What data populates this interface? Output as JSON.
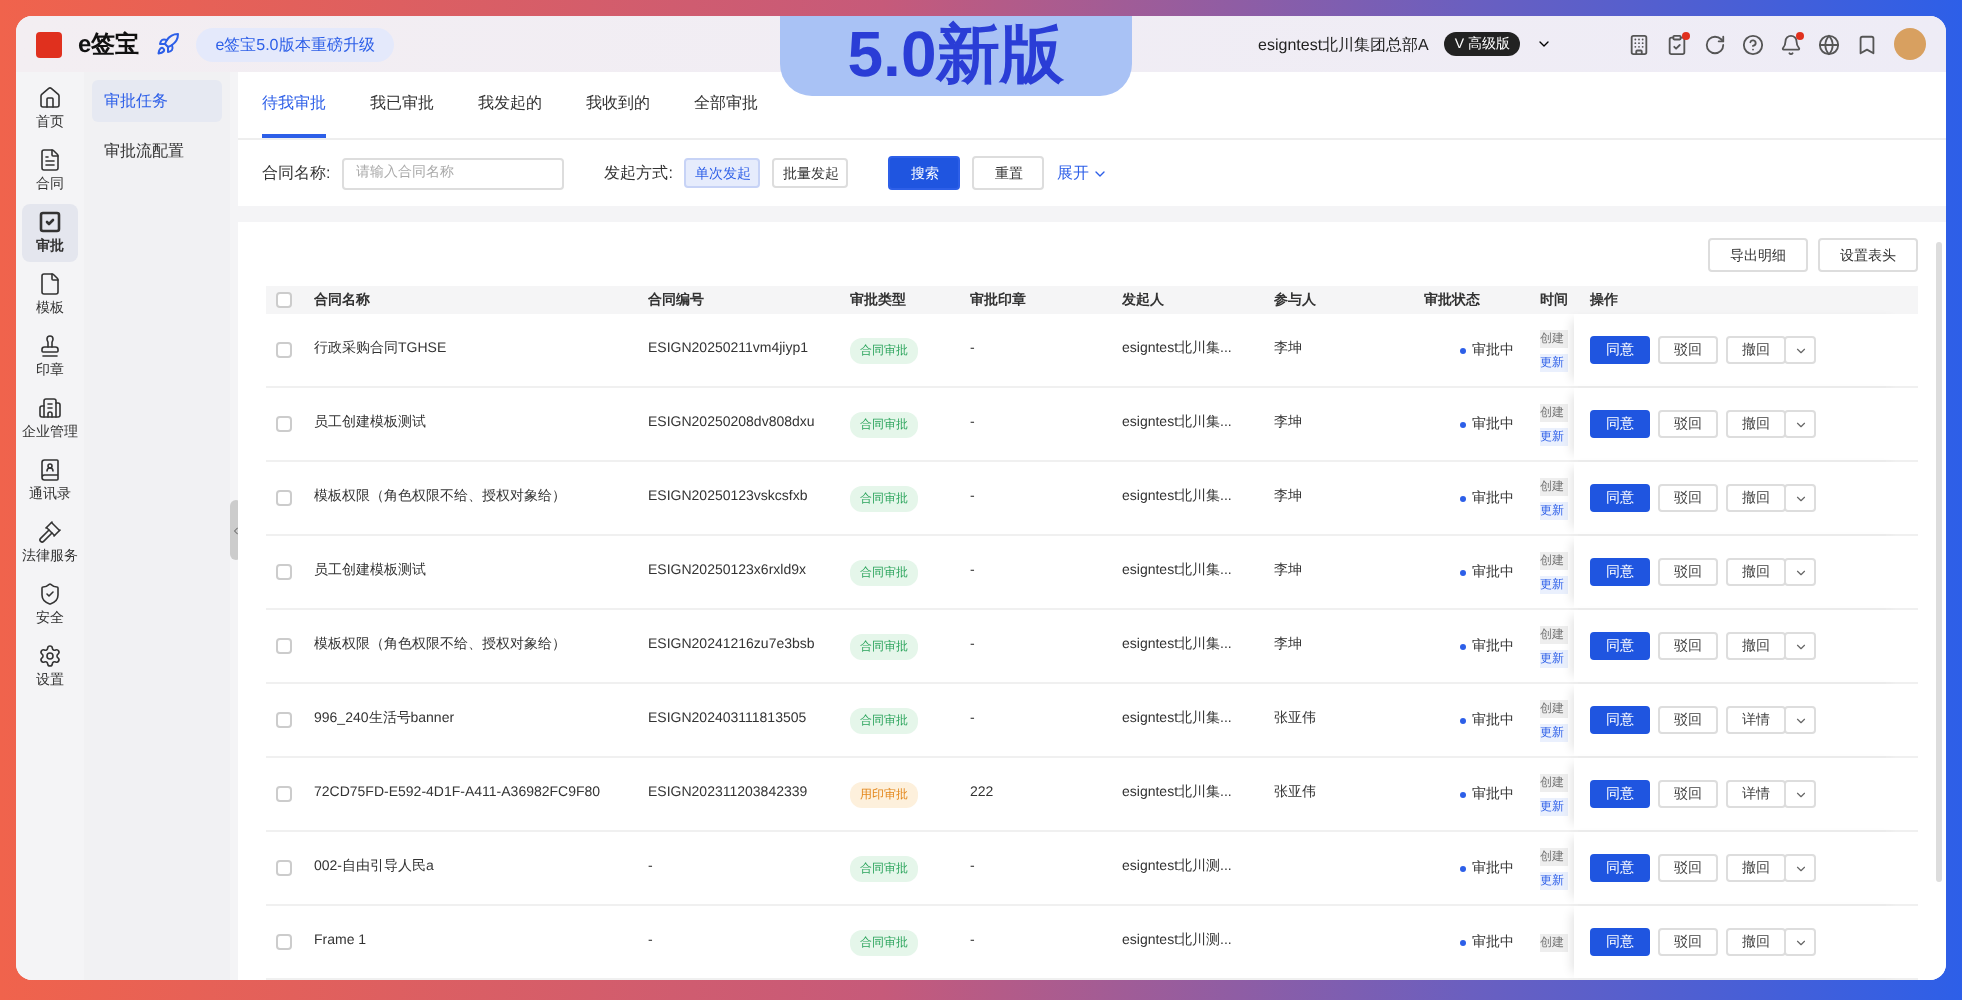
{
  "header": {
    "logo": "e签宝",
    "promo": "e签宝5.0版本重磅升级",
    "banner": "5.0新版",
    "account": "esigntest北川集团总部A",
    "plan_badge": "V 高级版"
  },
  "rail": [
    {
      "label": "首页",
      "selected": false
    },
    {
      "label": "合同",
      "selected": false
    },
    {
      "label": "审批",
      "selected": true
    },
    {
      "label": "模板",
      "selected": false
    },
    {
      "label": "印章",
      "selected": false
    },
    {
      "label": "企业管理",
      "selected": false
    },
    {
      "label": "通讯录",
      "selected": false
    },
    {
      "label": "法律服务",
      "selected": false
    },
    {
      "label": "安全",
      "selected": false
    },
    {
      "label": "设置",
      "selected": false
    }
  ],
  "submenu": [
    {
      "label": "审批任务",
      "selected": true
    },
    {
      "label": "审批流配置",
      "selected": false
    }
  ],
  "tabs": [
    {
      "label": "待我审批",
      "selected": true
    },
    {
      "label": "我已审批",
      "selected": false
    },
    {
      "label": "我发起的",
      "selected": false
    },
    {
      "label": "我收到的",
      "selected": false
    },
    {
      "label": "全部审批",
      "selected": false
    }
  ],
  "filters": {
    "name_label": "合同名称:",
    "name_placeholder": "请输入合同名称",
    "mode_label": "发起方式:",
    "modes": [
      {
        "label": "单次发起",
        "selected": true
      },
      {
        "label": "批量发起",
        "selected": false
      }
    ],
    "search": "搜索",
    "reset": "重置",
    "expand": "展开"
  },
  "toolbar": [
    "导出明细",
    "设置表头"
  ],
  "table": {
    "all_checked": false,
    "columns": [
      "合同名称",
      "合同编号",
      "审批类型",
      "审批印章",
      "发起人",
      "参与人",
      "审批状态",
      "时间",
      "操作"
    ],
    "rows": [
      {
        "checked": false,
        "name": "行政采购合同TGHSE",
        "code": "ESIGN20250211vm4jiyp1",
        "type": "合同审批",
        "kind": "contract",
        "seal": "-",
        "initiator": "esigntest北川集...",
        "participant": "李坤",
        "status": "审批中",
        "time_tags": [
          "创建",
          "更新"
        ],
        "actions": [
          "同意",
          "驳回",
          "撤回"
        ]
      },
      {
        "checked": false,
        "name": "员工创建模板测试",
        "code": "ESIGN20250208dv808dxu",
        "type": "合同审批",
        "kind": "contract",
        "seal": "-",
        "initiator": "esigntest北川集...",
        "participant": "李坤",
        "status": "审批中",
        "time_tags": [
          "创建",
          "更新"
        ],
        "actions": [
          "同意",
          "驳回",
          "撤回"
        ]
      },
      {
        "checked": false,
        "name": "模板权限（角色权限不给、授权对象给）",
        "code": "ESIGN20250123vskcsfxb",
        "type": "合同审批",
        "kind": "contract",
        "seal": "-",
        "initiator": "esigntest北川集...",
        "participant": "李坤",
        "status": "审批中",
        "time_tags": [
          "创建",
          "更新"
        ],
        "actions": [
          "同意",
          "驳回",
          "撤回"
        ]
      },
      {
        "checked": false,
        "name": "员工创建模板测试",
        "code": "ESIGN20250123x6rxld9x",
        "type": "合同审批",
        "kind": "contract",
        "seal": "-",
        "initiator": "esigntest北川集...",
        "participant": "李坤",
        "status": "审批中",
        "time_tags": [
          "创建",
          "更新"
        ],
        "actions": [
          "同意",
          "驳回",
          "撤回"
        ]
      },
      {
        "checked": false,
        "name": "模板权限（角色权限不给、授权对象给）",
        "code": "ESIGN20241216zu7e3bsb",
        "type": "合同审批",
        "kind": "contract",
        "seal": "-",
        "initiator": "esigntest北川集...",
        "participant": "李坤",
        "status": "审批中",
        "time_tags": [
          "创建",
          "更新"
        ],
        "actions": [
          "同意",
          "驳回",
          "撤回"
        ]
      },
      {
        "checked": false,
        "name": "996_240生活号banner",
        "code": "ESIGN202403111813505",
        "type": "合同审批",
        "kind": "contract",
        "seal": "-",
        "initiator": "esigntest北川集...",
        "participant": "张亚伟",
        "status": "审批中",
        "time_tags": [
          "创建",
          "更新"
        ],
        "actions": [
          "同意",
          "驳回",
          "详情"
        ]
      },
      {
        "checked": false,
        "name": "72CD75FD-E592-4D1F-A411-A36982FC9F80",
        "code": "ESIGN202311203842339",
        "type": "用印审批",
        "kind": "seal",
        "seal": "222",
        "initiator": "esigntest北川集...",
        "participant": "张亚伟",
        "status": "审批中",
        "time_tags": [
          "创建",
          "更新"
        ],
        "actions": [
          "同意",
          "驳回",
          "详情"
        ]
      },
      {
        "checked": false,
        "name": "002-自由引导人民a",
        "code": "-",
        "type": "合同审批",
        "kind": "contract",
        "seal": "-",
        "initiator": "esigntest北川测...",
        "status": "审批中",
        "time_tags": [
          "创建",
          "更新"
        ],
        "actions": [
          "同意",
          "驳回",
          "撤回"
        ]
      },
      {
        "checked": false,
        "name": "Frame 1",
        "code": "-",
        "type": "合同审批",
        "kind": "contract",
        "seal": "-",
        "initiator": "esigntest北川测...",
        "status": "审批中",
        "time_tags": [
          "创建"
        ],
        "actions": [
          "同意",
          "驳回",
          "撤回"
        ]
      }
    ]
  }
}
